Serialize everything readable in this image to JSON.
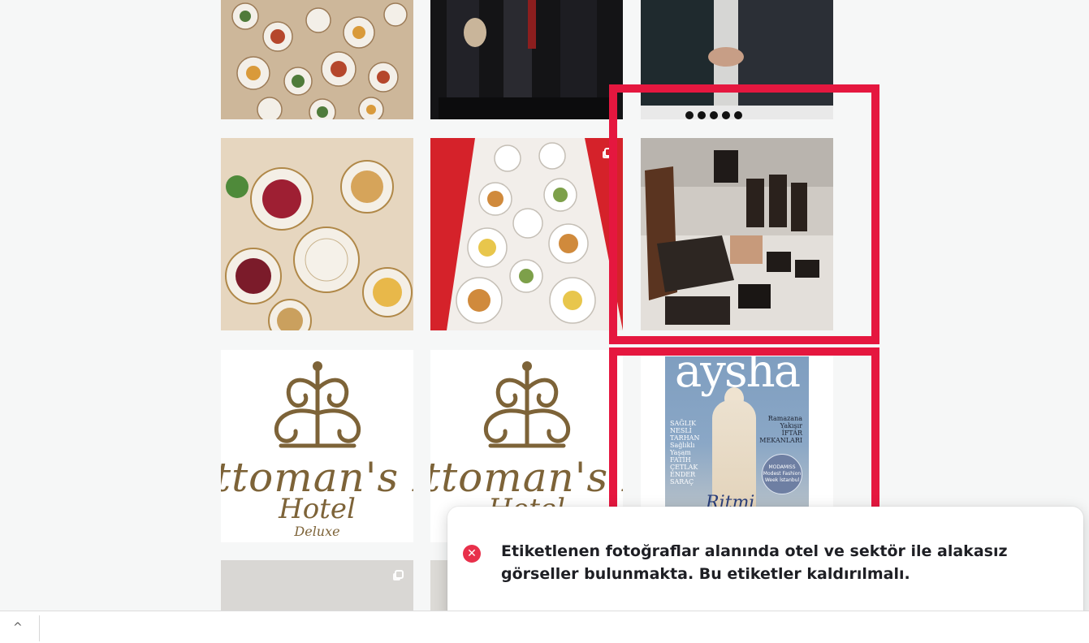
{
  "grid": {
    "row1": [
      {
        "name": "food-spread-photo",
        "colors": [
          "#b8743a",
          "#d8c7a8",
          "#4b6a37"
        ]
      },
      {
        "name": "award-ceremony-photo",
        "colors": [
          "#1a1a1a",
          "#3a3a44",
          "#8b1e1e"
        ]
      },
      {
        "name": "handshake-photo",
        "colors": [
          "#1c2226",
          "#2f3a40",
          "#c9c9c9"
        ]
      }
    ],
    "row2": [
      {
        "name": "iftar-table-photo",
        "colors": [
          "#a3262e",
          "#e1c08b",
          "#f2ece3"
        ]
      },
      {
        "name": "long-table-food-photo",
        "colors": [
          "#d91f26",
          "#eeeae4",
          "#c68a4a"
        ]
      },
      {
        "name": "leather-amenities-photo",
        "colors": [
          "#2b211c",
          "#8a6a57",
          "#cfc9c3"
        ]
      }
    ],
    "logo": {
      "script": "ttoman's Li",
      "hotel": "Hotel",
      "deluxe": "Deluxe"
    },
    "magazine": {
      "title": "aysha",
      "left_lines": [
        "SAĞLIK",
        "NESLİ",
        "TARHAN",
        "Sağlıklı Yaşam",
        "FATİH",
        "ÇETLAK",
        "ENDER",
        "SARAÇ"
      ],
      "right_lines": [
        "Ramazana",
        "Yakışır",
        "İFTAR",
        "MEKANLARI"
      ],
      "badge": "MODAMISS Modest Fashion Week İstanbul",
      "script": "Ritmi"
    }
  },
  "toast": {
    "icon": "close-circle-icon",
    "message": "Etiketlenen fotoğraflar alanında otel ve sektör ile alakasız görseller bulunmakta. Bu etiketler kaldırılmalı."
  },
  "bottombar": {
    "chevron": "^"
  },
  "colors": {
    "highlight": "#e5173f",
    "error": "#e8304b"
  }
}
